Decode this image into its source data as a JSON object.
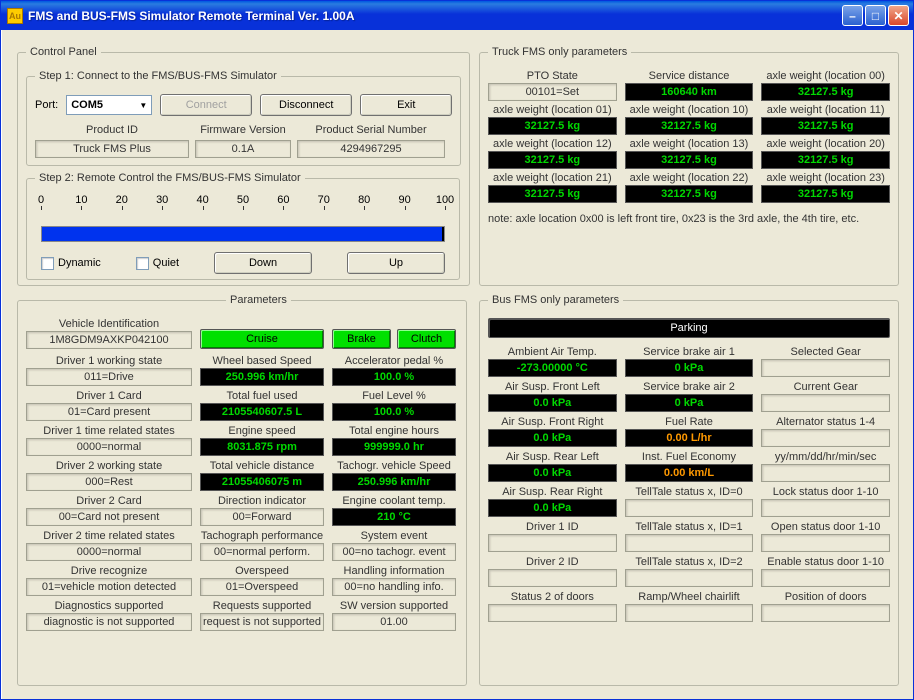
{
  "window": {
    "title": "FMS and BUS-FMS Simulator Remote Terminal Ver. 1.00A"
  },
  "control_panel": {
    "title": "Control Panel",
    "step1": {
      "title": "Step 1: Connect to the FMS/BUS-FMS Simulator",
      "port_label": "Port:",
      "port_value": "COM5",
      "connect_btn": "Connect",
      "disconnect_btn": "Disconnect",
      "exit_btn": "Exit",
      "product_id_label": "Product ID",
      "product_id_value": "Truck FMS Plus",
      "fw_label": "Firmware Version",
      "fw_value": "0.1A",
      "serial_label": "Product Serial Number",
      "serial_value": "4294967295"
    },
    "step2": {
      "title": "Step 2: Remote Control the FMS/BUS-FMS Simulator",
      "ticks": [
        "0",
        "10",
        "20",
        "30",
        "40",
        "50",
        "60",
        "70",
        "80",
        "90",
        "100"
      ],
      "progress_pct": 100,
      "dynamic_label": "Dynamic",
      "quiet_label": "Quiet",
      "down_btn": "Down",
      "up_btn": "Up"
    }
  },
  "truck_fms": {
    "title": "Truck FMS only parameters",
    "labels": {
      "pto": "PTO State",
      "service_dist": "Service distance",
      "axl00": "axle weight (location 00)",
      "axl01": "axle weight (location 01)",
      "axl10": "axle weight (location 10)",
      "axl11": "axle weight (location 11)",
      "axl12": "axle weight (location 12)",
      "axl13": "axle weight (location 13)",
      "axl20": "axle weight (location 20)",
      "axl21": "axle weight (location 21)",
      "axl22": "axle weight (location 22)",
      "axl23": "axle weight (location 23)"
    },
    "values": {
      "pto": "00101=Set",
      "service_dist": "160640 km",
      "axl00": "32127.5 kg",
      "axl01": "32127.5 kg",
      "axl10": "32127.5 kg",
      "axl11": "32127.5 kg",
      "axl12": "32127.5 kg",
      "axl13": "32127.5 kg",
      "axl20": "32127.5 kg",
      "axl21": "32127.5 kg",
      "axl22": "32127.5 kg",
      "axl23": "32127.5 kg"
    },
    "note": "note: axle location 0x00 is left front tire, 0x23 is the 3rd axle, the 4th tire, etc."
  },
  "parameters": {
    "title": "Parameters",
    "vehicle_id_label": "Vehicle Identification",
    "vehicle_id_value": "1M8GDM9AXKP042100",
    "cruise_btn": "Cruise",
    "brake_btn": "Brake",
    "clutch_btn": "Clutch",
    "left_column": [
      {
        "label": "Driver 1 working state",
        "value": "011=Drive"
      },
      {
        "label": "Driver 1 Card",
        "value": "01=Card present"
      },
      {
        "label": "Driver 1 time related states",
        "value": "0000=normal"
      },
      {
        "label": "Driver 2 working state",
        "value": "000=Rest"
      },
      {
        "label": "Driver 2 Card",
        "value": "00=Card not present"
      },
      {
        "label": "Driver 2 time related states",
        "value": "0000=normal"
      },
      {
        "label": "Drive recognize",
        "value": "01=vehicle motion detected"
      },
      {
        "label": "Diagnostics supported",
        "value": "diagnostic is not supported"
      }
    ],
    "mid_column": [
      {
        "label": "Wheel based Speed",
        "value": "250.996 km/hr",
        "lcd": true
      },
      {
        "label": "Total fuel used",
        "value": "2105540607.5 L",
        "lcd": true
      },
      {
        "label": "Engine speed",
        "value": "8031.875 rpm",
        "lcd": true
      },
      {
        "label": "Total vehicle distance",
        "value": "21055406075 m",
        "lcd": true
      },
      {
        "label": "Direction indicator",
        "value": "00=Forward"
      },
      {
        "label": "Tachograph performance",
        "value": "00=normal perform."
      },
      {
        "label": "Overspeed",
        "value": "01=Overspeed"
      },
      {
        "label": "Requests supported",
        "value": "request is not supported"
      }
    ],
    "right_column": [
      {
        "label": "Accelerator pedal %",
        "value": "100.0 %",
        "lcd": true
      },
      {
        "label": "Fuel Level %",
        "value": "100.0 %",
        "lcd": true
      },
      {
        "label": "Total engine hours",
        "value": "999999.0 hr",
        "lcd": true
      },
      {
        "label": "Tachogr. vehicle Speed",
        "value": "250.996 km/hr",
        "lcd": true
      },
      {
        "label": "Engine coolant temp.",
        "value": "210 °C",
        "lcd": true
      },
      {
        "label": "System event",
        "value": "00=no tachogr. event"
      },
      {
        "label": "Handling information",
        "value": "00=no handling info."
      },
      {
        "label": "SW version supported",
        "value": "01.00"
      }
    ]
  },
  "bus_fms": {
    "title": "Bus FMS only parameters",
    "parking": "Parking",
    "cols": [
      [
        {
          "l": "Ambient Air Temp.",
          "v": "-273.00000 °C",
          "lcd": true,
          "orange": false
        },
        {
          "l": "Air Susp. Front Left",
          "v": "0.0 kPa",
          "lcd": true
        },
        {
          "l": "Air Susp. Front Right",
          "v": "0.0 kPa",
          "lcd": true
        },
        {
          "l": "Air Susp. Rear Left",
          "v": "0.0 kPa",
          "lcd": true
        },
        {
          "l": "Air Susp. Rear Right",
          "v": "0.0 kPa",
          "lcd": true
        },
        {
          "l": "Driver 1 ID",
          "v": ""
        },
        {
          "l": "Driver 2 ID",
          "v": ""
        },
        {
          "l": "Status 2 of doors",
          "v": ""
        }
      ],
      [
        {
          "l": "Service brake air 1",
          "v": "0 kPa",
          "lcd": true
        },
        {
          "l": "Service brake air 2",
          "v": "0 kPa",
          "lcd": true
        },
        {
          "l": "Fuel Rate",
          "v": "0.00 L/hr",
          "lcd": true,
          "orange": true
        },
        {
          "l": "Inst. Fuel Economy",
          "v": "0.00 km/L",
          "lcd": true,
          "orange": true
        },
        {
          "l": "TellTale status x, ID=0",
          "v": ""
        },
        {
          "l": "TellTale status x, ID=1",
          "v": ""
        },
        {
          "l": "TellTale status x, ID=2",
          "v": ""
        },
        {
          "l": "Ramp/Wheel chairlift",
          "v": ""
        }
      ],
      [
        {
          "l": "Selected Gear",
          "v": ""
        },
        {
          "l": "Current Gear",
          "v": ""
        },
        {
          "l": "Alternator status 1-4",
          "v": ""
        },
        {
          "l": "yy/mm/dd/hr/min/sec",
          "v": ""
        },
        {
          "l": "Lock status door 1-10",
          "v": ""
        },
        {
          "l": "Open status door 1-10",
          "v": ""
        },
        {
          "l": "Enable status door 1-10",
          "v": ""
        },
        {
          "l": "Position of doors",
          "v": ""
        }
      ]
    ]
  }
}
